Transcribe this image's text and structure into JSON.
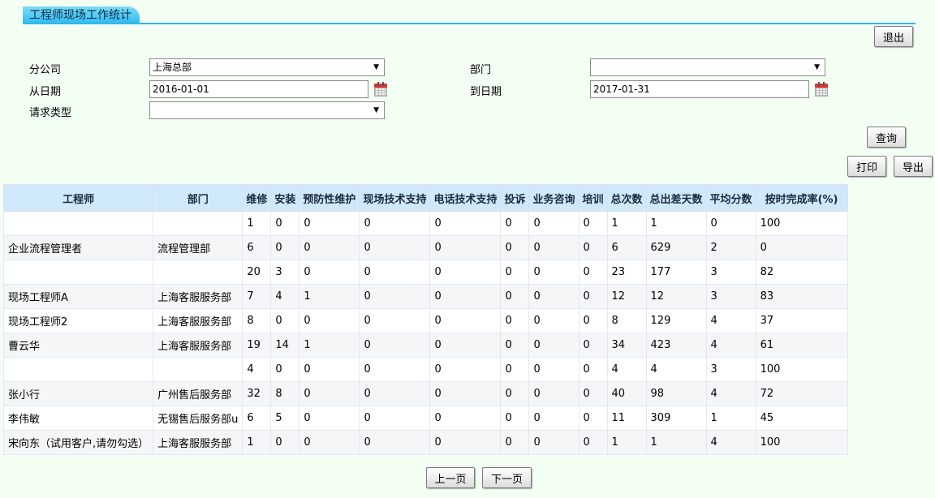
{
  "page": {
    "title": "工程师现场工作统计"
  },
  "buttons": {
    "exit": "退出",
    "query": "查询",
    "print": "打印",
    "export": "导出",
    "prev": "上一页",
    "next": "下一页"
  },
  "filters": {
    "branch_label": "分公司",
    "branch_value": "上海总部",
    "dept_label": "部门",
    "dept_value": "",
    "from_label": "从日期",
    "from_value": "2016-01-01",
    "to_label": "到日期",
    "to_value": "2017-01-31",
    "reqtype_label": "请求类型",
    "reqtype_value": ""
  },
  "icons": {
    "dropdown": "chevron-down-icon",
    "calendar": "calendar-icon"
  },
  "colors": {
    "header_bg": "#cfe9fb",
    "tab": "#2fb8ec",
    "page_bg": "#f4fff4"
  },
  "table": {
    "headers": [
      "工程师",
      "部门",
      "维修",
      "安装",
      "预防性维护",
      "现场技术支持",
      "电话技术支持",
      "投诉",
      "业务咨询",
      "培训",
      "总次数",
      "总出差天数",
      "平均分数",
      "按时完成率(%)"
    ],
    "rows": [
      [
        "",
        "",
        "1",
        "0",
        "0",
        "0",
        "0",
        "0",
        "0",
        "0",
        "1",
        "1",
        "0",
        "100"
      ],
      [
        "企业流程管理者",
        "流程管理部",
        "6",
        "0",
        "0",
        "0",
        "0",
        "0",
        "0",
        "0",
        "6",
        "629",
        "2",
        "0"
      ],
      [
        "",
        "",
        "20",
        "3",
        "0",
        "0",
        "0",
        "0",
        "0",
        "0",
        "23",
        "177",
        "3",
        "82"
      ],
      [
        "现场工程师A",
        "上海客服服务部",
        "7",
        "4",
        "1",
        "0",
        "0",
        "0",
        "0",
        "0",
        "12",
        "12",
        "3",
        "83"
      ],
      [
        "现场工程师2",
        "上海客服服务部",
        "8",
        "0",
        "0",
        "0",
        "0",
        "0",
        "0",
        "0",
        "8",
        "129",
        "4",
        "37"
      ],
      [
        "曹云华",
        "上海客服服务部",
        "19",
        "14",
        "1",
        "0",
        "0",
        "0",
        "0",
        "0",
        "34",
        "423",
        "4",
        "61"
      ],
      [
        "",
        "",
        "4",
        "0",
        "0",
        "0",
        "0",
        "0",
        "0",
        "0",
        "4",
        "4",
        "3",
        "100"
      ],
      [
        "张小行",
        "广州售后服务部",
        "32",
        "8",
        "0",
        "0",
        "0",
        "0",
        "0",
        "0",
        "40",
        "98",
        "4",
        "72"
      ],
      [
        "李伟敏",
        "无锡售后服务部u",
        "6",
        "5",
        "0",
        "0",
        "0",
        "0",
        "0",
        "0",
        "11",
        "309",
        "1",
        "45"
      ],
      [
        "宋向东（试用客户,请勿勾选）",
        "上海客服服务部",
        "1",
        "0",
        "0",
        "0",
        "0",
        "0",
        "0",
        "0",
        "1",
        "1",
        "4",
        "100"
      ]
    ]
  }
}
